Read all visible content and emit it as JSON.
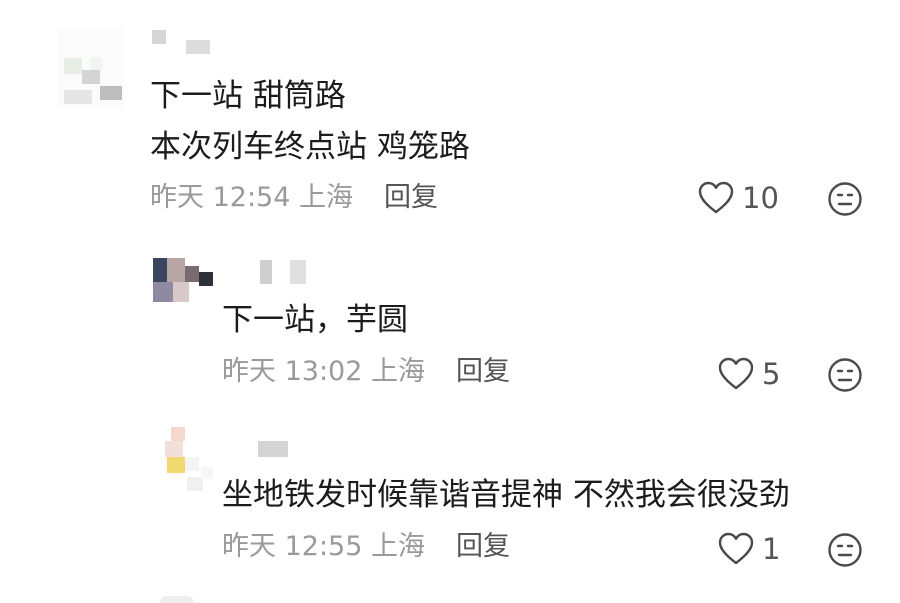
{
  "comments": [
    {
      "lines": [
        "下一站 甜筒路",
        "本次列车终点站 鸡笼路"
      ],
      "time": "昨天 12:54",
      "location": "上海",
      "reply_label": "回复",
      "likes": "10"
    },
    {
      "lines": [
        "下一站，芋圆"
      ],
      "time": "昨天 13:02",
      "location": "上海",
      "reply_label": "回复",
      "likes": "5"
    },
    {
      "lines": [
        "坐地铁发时候靠谐音提神 不然我会很没劲"
      ],
      "time": "昨天 12:55",
      "location": "上海",
      "reply_label": "回复",
      "likes": "1"
    }
  ],
  "icons": {
    "like": "heart-outline-icon",
    "dislike": "meh-face-icon"
  },
  "colors": {
    "text": "#1c1c1c",
    "meta": "#9a9a9a",
    "action": "#555555"
  }
}
